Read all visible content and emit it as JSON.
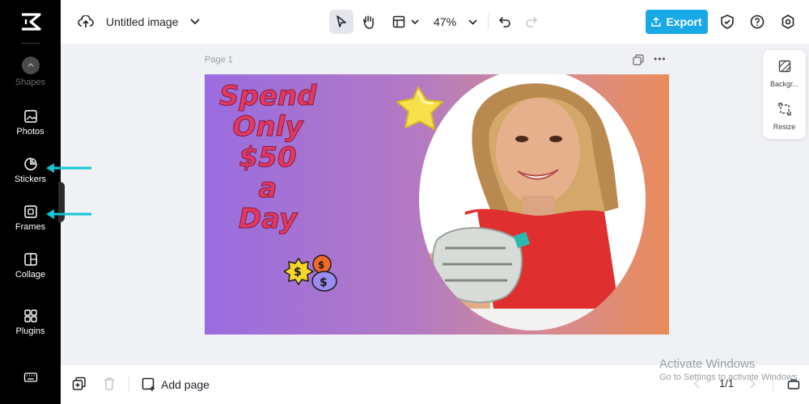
{
  "sidebar": {
    "items": [
      {
        "label": "Shapes"
      },
      {
        "label": "Photos"
      },
      {
        "label": "Stickers"
      },
      {
        "label": "Frames"
      },
      {
        "label": "Collage"
      },
      {
        "label": "Plugins"
      }
    ]
  },
  "header": {
    "title": "Untitled image",
    "zoom": "47%",
    "export_label": "Export"
  },
  "canvas": {
    "page_label": "Page 1",
    "headline_lines": [
      "Spend",
      "Only",
      "$50",
      "a",
      "Day"
    ]
  },
  "side_panel": {
    "background_label": "Backgr...",
    "resize_label": "Resize"
  },
  "footer": {
    "add_page_label": "Add page",
    "page_count": "1/1"
  },
  "watermark": {
    "title": "Activate Windows",
    "subtitle": "Go to Settings to activate Windows."
  },
  "colors": {
    "accent": "#19a9e6",
    "arrow": "#13c6d6",
    "headline": "#e03a63"
  },
  "icons": [
    "capcut-logo-icon",
    "shapes-icon",
    "photos-icon",
    "stickers-icon",
    "frames-icon",
    "collage-icon",
    "plugins-icon",
    "keyboard-icon",
    "cloud-upload-icon",
    "chevron-down-icon",
    "pointer-icon",
    "hand-icon",
    "layout-icon",
    "undo-icon",
    "redo-icon",
    "shield-icon",
    "help-icon",
    "settings-icon",
    "copy-page-icon",
    "more-icon",
    "background-icon",
    "resize-icon",
    "duplicate-icon",
    "trash-icon",
    "add-page-icon"
  ]
}
